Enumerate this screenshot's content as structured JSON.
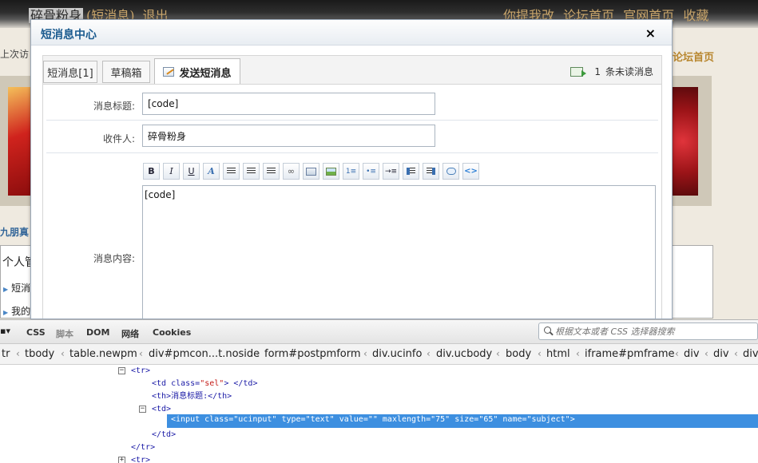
{
  "forum": {
    "username": "碎骨粉身",
    "pm_link": "(短消息)",
    "logout": "退出",
    "right_links": [
      "你提我改",
      "论坛首页",
      "官网首页",
      "收藏"
    ],
    "last_visit_fragment": "上次访",
    "forum_home_fragment": "论坛首页",
    "jiupeng_fragment": "九朋真",
    "personal_fragment": "个人管",
    "item1_fragment": "短消",
    "item2_fragment": "我的"
  },
  "modal": {
    "title": "短消息中心",
    "close_symbol": "×",
    "tabs": {
      "inbox": "短消息[1]",
      "drafts": "草稿箱",
      "compose": "发送短消息"
    },
    "unread": {
      "count": "1",
      "label": "条未读消息"
    },
    "form": {
      "subject_label": "消息标题:",
      "subject_value": "[code]",
      "recipient_label": "收件人:",
      "recipient_value": "碎骨粉身",
      "content_label": "消息内容:",
      "content_value": "[code]"
    },
    "editor_toolbar": {
      "bold": "B",
      "italic": "I",
      "underline": "U",
      "fontcolor": "A"
    }
  },
  "devtools": {
    "tabs": [
      "CSS",
      "脚本",
      "DOM",
      "网络",
      "Cookies"
    ],
    "search_placeholder": "根据文本或者 CSS 选择器搜索",
    "breadcrumb": [
      "tr",
      "tbody",
      "table.newpm",
      "div#pmcon...t.noside",
      "form#postpmform",
      "div.ucinfo",
      "div.ucbody",
      "body",
      "html",
      "iframe#pmframe",
      "div",
      "div",
      "div"
    ],
    "tree": {
      "tr_open": "<tr>",
      "td_open_pre": "<td class=",
      "td_class_val": "\"sel\"",
      "td_close_post": "> </td>",
      "th_line": "<th>消息标题:</th>",
      "td_open": "<td>",
      "selected_input": "<input class=\"ucinput\" type=\"text\" value=\"\" maxlength=\"75\" size=\"65\" name=\"subject\">",
      "td_close": "</td>",
      "tr_close": "</tr>",
      "tr_next": "<tr>"
    }
  }
}
